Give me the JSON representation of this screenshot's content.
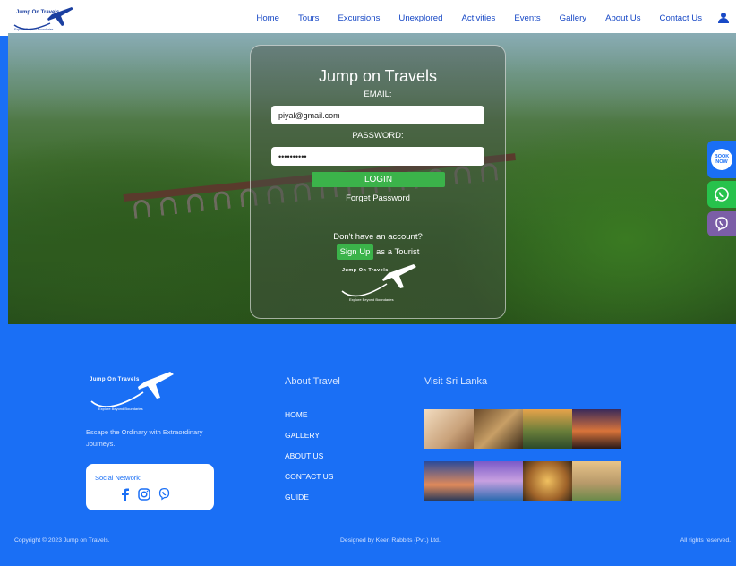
{
  "nav": {
    "logo_text": "Jump On Travels",
    "logo_slogan": "Explore Beyond Boundaries",
    "links": [
      "Home",
      "Tours",
      "Excursions",
      "Unexplored",
      "Activities",
      "Events",
      "Gallery",
      "About Us",
      "Contact Us"
    ]
  },
  "login": {
    "title": "Jump on Travels",
    "email_label": "EMAIL:",
    "email_value": "piyal@gmail.com",
    "password_label": "PASSWORD:",
    "password_value": "••••••••••",
    "login_button": "LOGIN",
    "forget_password": "Forget Password",
    "no_account": "Don't have an account?",
    "signup_button": "Sign Up",
    "signup_suffix": "as a Tourist",
    "logo_text": "Jump On Travels",
    "logo_slogan": "Explore Beyond Boundaries"
  },
  "side_buttons": {
    "book_now": "BOOK NOW"
  },
  "footer": {
    "logo_text": "Jump On Travels",
    "logo_slogan": "Explore Beyond Boundaries",
    "tagline": "Escape the Ordinary with Extraordinary Journeys.",
    "social_title": "Social Network:",
    "about_heading": "About Travel",
    "links": [
      "HOME",
      "GALLERY",
      "ABOUT US",
      "CONTACT US",
      "GUIDE"
    ],
    "visit_heading": "Visit Sri Lanka",
    "copyright": "Copyright © 2023 Jump on Travels.",
    "designed_by": "Designed by Keen Rabbits (Pvt.) Ltd.",
    "rights": "All rights reserved."
  },
  "colors": {
    "brand_blue": "#1a6ff5",
    "nav_link": "#1849c6",
    "green_button": "#3bb34a",
    "whatsapp": "#27c24c",
    "viber": "#7b5ea7"
  },
  "icons": [
    "user-icon",
    "whatsapp-icon",
    "viber-icon",
    "facebook-icon",
    "instagram-icon",
    "plane-icon"
  ]
}
